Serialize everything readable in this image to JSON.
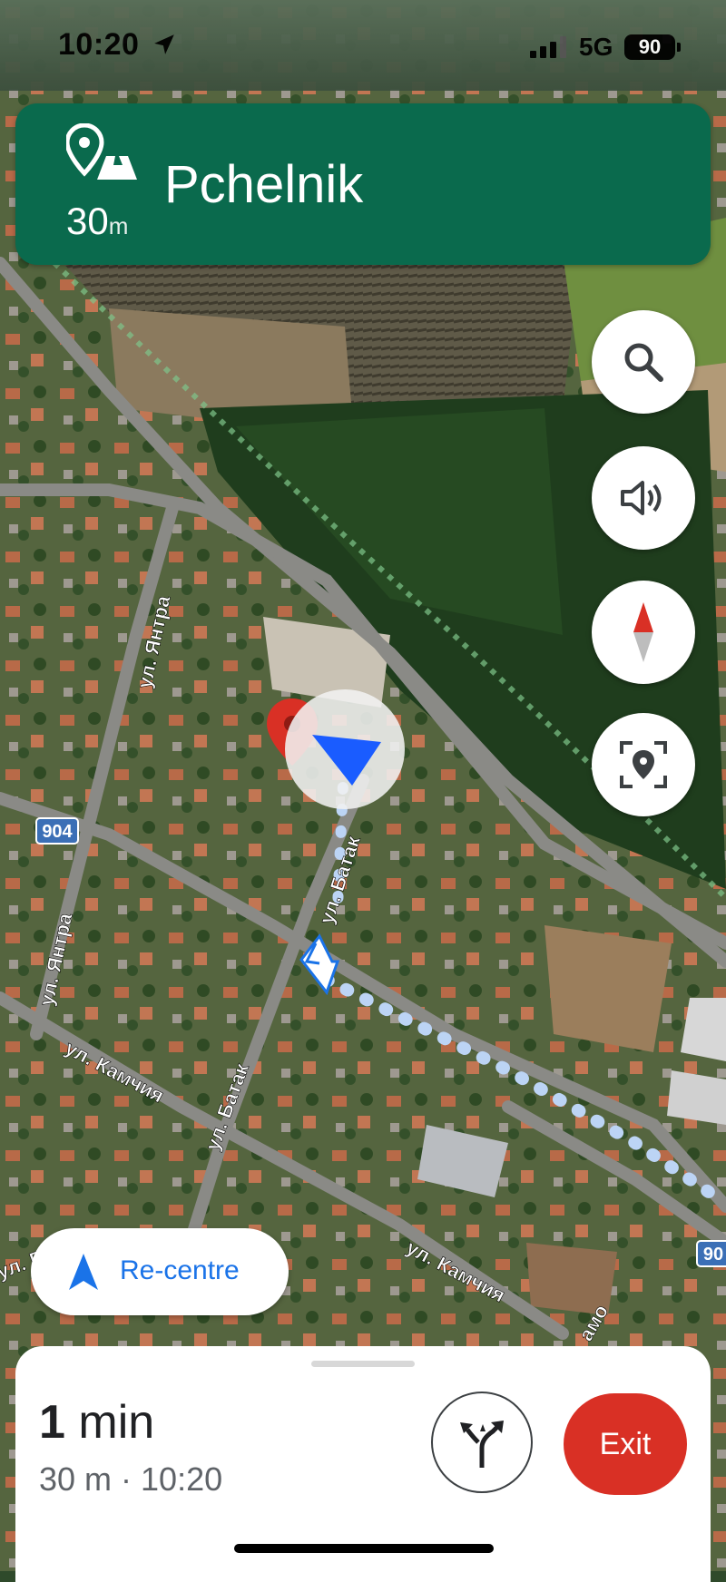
{
  "status_bar": {
    "time": "10:20",
    "network": "5G",
    "battery": "90"
  },
  "banner": {
    "distance_value": "30",
    "distance_unit": "m",
    "street": "Pchelnik",
    "maneuver_icon": "destination-pin-with-buildings-icon"
  },
  "map": {
    "labels": [
      {
        "text": "ул. Янтра"
      },
      {
        "text": "ул. Янтра"
      },
      {
        "text": "904"
      },
      {
        "text": "ул. Батак"
      },
      {
        "text": "ул. Батак"
      },
      {
        "text": "ул. Камчия"
      },
      {
        "text": "ул. Камчия"
      },
      {
        "text": "90"
      },
      {
        "text": "ул. Б"
      },
      {
        "text": "амо"
      }
    ]
  },
  "side_buttons": [
    {
      "name": "search",
      "icon": "search-icon"
    },
    {
      "name": "sound",
      "icon": "speaker-icon"
    },
    {
      "name": "compass",
      "icon": "compass-icon"
    },
    {
      "name": "report",
      "icon": "location-report-icon"
    }
  ],
  "recentre": {
    "label": "Re-centre"
  },
  "trip": {
    "duration_value": "1",
    "duration_unit": "min",
    "summary": "30 m · 10:20",
    "exit_label": "Exit"
  },
  "colors": {
    "banner_bg": "#0a6a4d",
    "exit_bg": "#d93025",
    "accent_blue": "#1a73e8",
    "route_dots": "#bcd4f5"
  }
}
